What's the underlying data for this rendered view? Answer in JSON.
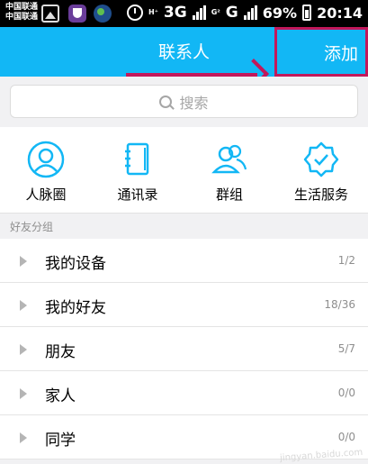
{
  "status_bar": {
    "carrier_1": "中国联通",
    "carrier_2": "中国联通",
    "network_1": "H⁺",
    "network_2": "G²",
    "gen_1": "3G",
    "gen_2": "G",
    "battery": "69%",
    "time": "20:14"
  },
  "header": {
    "title": "联系人",
    "add_label": "添加"
  },
  "search": {
    "placeholder": "搜索"
  },
  "shortcuts": [
    {
      "label": "人脉圈",
      "icon": "person-circle-icon"
    },
    {
      "label": "通讯录",
      "icon": "address-book-icon"
    },
    {
      "label": "群组",
      "icon": "group-icon"
    },
    {
      "label": "生活服务",
      "icon": "service-badge-icon"
    }
  ],
  "groups": {
    "section_title": "好友分组",
    "items": [
      {
        "name": "我的设备",
        "count": "1/2"
      },
      {
        "name": "我的好友",
        "count": "18/36"
      },
      {
        "name": "朋友",
        "count": "5/7"
      },
      {
        "name": "家人",
        "count": "0/0"
      },
      {
        "name": "同学",
        "count": "0/0"
      }
    ]
  },
  "colors": {
    "accent": "#12b7f5",
    "annotation": "#c2185b"
  },
  "watermark": "jingyan.baidu.com"
}
